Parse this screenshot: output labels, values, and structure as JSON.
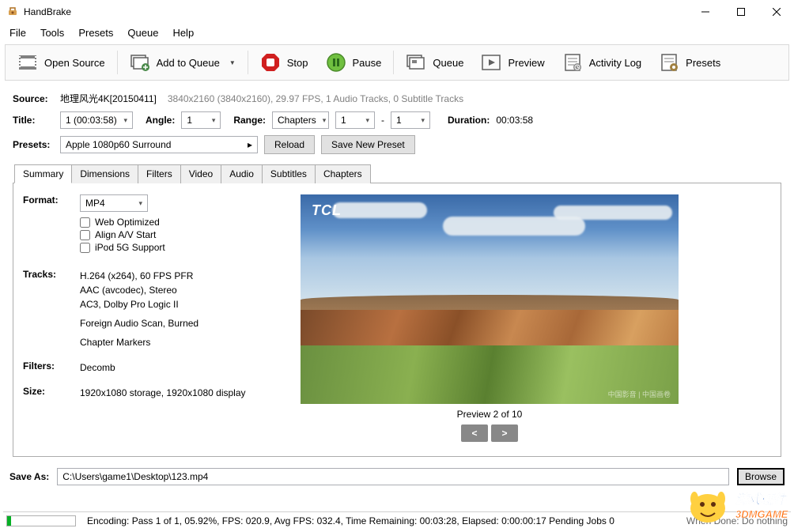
{
  "window": {
    "title": "HandBrake"
  },
  "menu": {
    "file": "File",
    "tools": "Tools",
    "presets": "Presets",
    "queue": "Queue",
    "help": "Help"
  },
  "toolbar": {
    "open_source": "Open Source",
    "add_to_queue": "Add to Queue",
    "stop": "Stop",
    "pause": "Pause",
    "queue": "Queue",
    "preview": "Preview",
    "activity_log": "Activity Log",
    "presets": "Presets"
  },
  "source": {
    "label": "Source:",
    "name": "地理风光4K[20150411]",
    "meta": "3840x2160 (3840x2160), 29.97 FPS, 1 Audio Tracks, 0 Subtitle Tracks"
  },
  "title_row": {
    "title_label": "Title:",
    "title_value": "1 (00:03:58)",
    "angle_label": "Angle:",
    "angle_value": "1",
    "range_label": "Range:",
    "range_type": "Chapters",
    "range_from": "1",
    "range_dash": "-",
    "range_to": "1",
    "duration_label": "Duration:",
    "duration_value": "00:03:58"
  },
  "presets_row": {
    "label": "Presets:",
    "value": "Apple 1080p60 Surround",
    "reload": "Reload",
    "save_new": "Save New Preset"
  },
  "tabs": {
    "summary": "Summary",
    "dimensions": "Dimensions",
    "filters": "Filters",
    "video": "Video",
    "audio": "Audio",
    "subtitles": "Subtitles",
    "chapters": "Chapters"
  },
  "summary": {
    "format_label": "Format:",
    "format_value": "MP4",
    "web_optimized": "Web Optimized",
    "align_av": "Align A/V Start",
    "ipod_5g": "iPod 5G Support",
    "tracks_label": "Tracks:",
    "tracks_line1": "H.264 (x264), 60 FPS PFR",
    "tracks_line2": "AAC (avcodec), Stereo",
    "tracks_line3": "AC3, Dolby Pro Logic II",
    "tracks_line4": "Foreign Audio Scan, Burned",
    "tracks_line5": "Chapter Markers",
    "filters_label": "Filters:",
    "filters_value": "Decomb",
    "size_label": "Size:",
    "size_value": "1920x1080 storage, 1920x1080 display"
  },
  "preview": {
    "watermark": "TCL",
    "caption": "Preview 2 of 10",
    "prev": "<",
    "next": ">",
    "corner": "中国影音 | 中国画卷"
  },
  "save": {
    "label": "Save As:",
    "path": "C:\\Users\\game1\\Desktop\\123.mp4",
    "browse": "Browse"
  },
  "status": {
    "text": "Encoding: Pass 1 of 1,  05.92%, FPS: 020.9,  Avg FPS: 032.4,  Time Remaining: 00:03:28,  Elapsed: 0:00:00:17    Pending Jobs 0",
    "right": "When Done: Do nothing"
  },
  "overlay": {
    "text1": "游戏硬件",
    "text2": "3DMGAME"
  }
}
